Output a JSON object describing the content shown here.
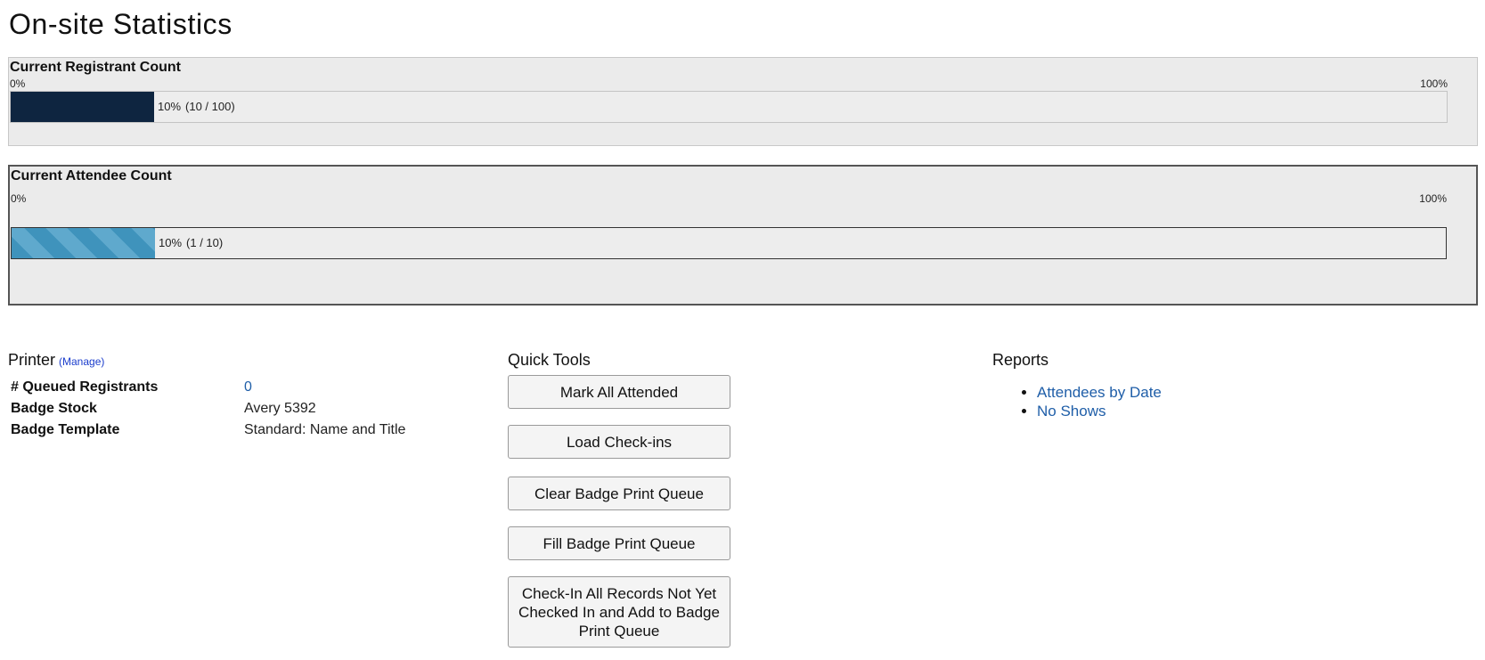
{
  "page": {
    "title": "On-site Statistics"
  },
  "registrant": {
    "label": "Current Registrant Count",
    "scale_min": "0%",
    "scale_max": "100%",
    "percent_text": "10%",
    "count_text": "(10 / 100)",
    "value": 10,
    "total": 100,
    "fraction": 0.1,
    "fill_color": "#0e2540"
  },
  "attendee": {
    "label": "Current Attendee Count",
    "scale_min": "0%",
    "scale_max": "100%",
    "percent_text": "10%",
    "count_text": "(1 / 10)",
    "value": 1,
    "total": 10,
    "fraction": 0.1,
    "fill_color": "#3f93bc"
  },
  "printer": {
    "heading": "Printer",
    "manage_label": "(Manage)",
    "rows": [
      {
        "key": "# Queued Registrants",
        "value": "0"
      },
      {
        "key": "Badge Stock",
        "value": "Avery 5392"
      },
      {
        "key": "Badge Template",
        "value": "Standard: Name and Title"
      }
    ]
  },
  "quick_tools": {
    "heading": "Quick Tools",
    "buttons": [
      "Mark All Attended",
      "Load Check-ins",
      "Clear Badge Print Queue",
      "Fill Badge Print Queue",
      "Check-In All Records Not Yet Checked In and Add to Badge Print Queue"
    ]
  },
  "reports": {
    "heading": "Reports",
    "links": [
      "Attendees by Date",
      "No Shows"
    ]
  },
  "colors": {
    "link": "#1f5ea8",
    "manage_link": "#1a3ccc",
    "panel_bg": "#ebebeb"
  }
}
